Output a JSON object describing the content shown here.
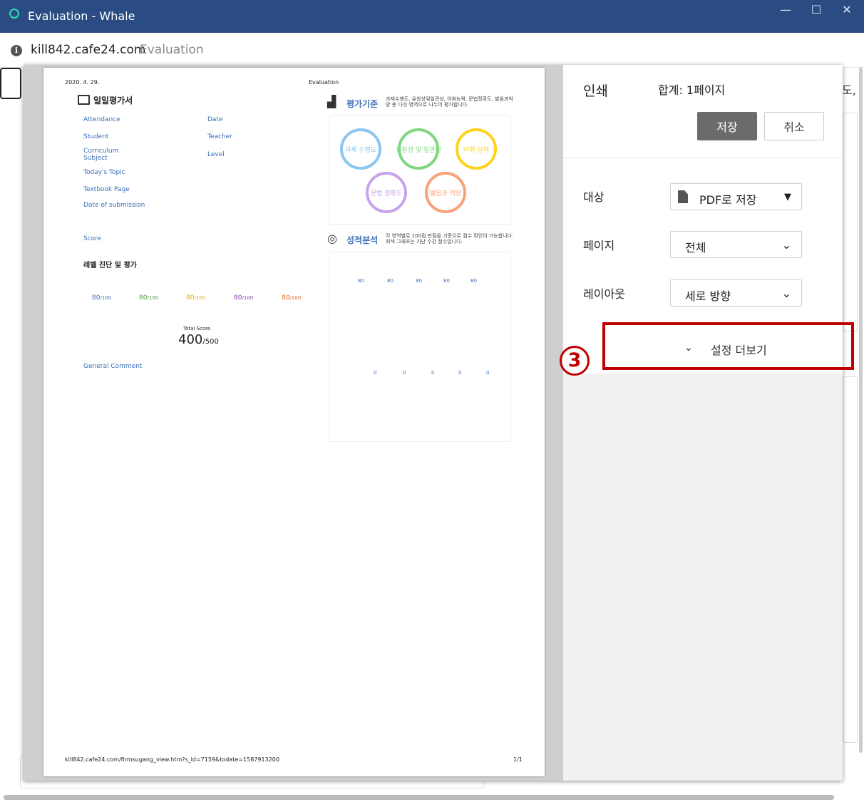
{
  "window": {
    "title": "Evaluation - Whale",
    "controls": {
      "minimize": "—",
      "maximize": "☐",
      "close": "✕"
    }
  },
  "address": {
    "info_icon": "i",
    "url": "kill842.cafe24.com",
    "title": "Evaluation"
  },
  "background": {
    "edge_text": "도,"
  },
  "preview": {
    "date": "2020. 4. 29.",
    "header": "Evaluation",
    "doc_title": "일일평가서",
    "labels": {
      "attendance": "Attendance",
      "date": "Date",
      "student": "Student",
      "teacher": "Teacher",
      "curriculum": "Curriculum",
      "subject": "Subject",
      "level": "Level",
      "topic": "Today's Topic",
      "textbook": "Textbook Page",
      "submission": "Date of submission",
      "score": "Score"
    },
    "level_title": "레벨 진단 및 평가",
    "scores": [
      {
        "value": "80",
        "max": "/100",
        "color": "#3b6fb8"
      },
      {
        "value": "80",
        "max": "/100",
        "color": "#4a9a3a"
      },
      {
        "value": "80",
        "max": "/100",
        "color": "#e0a800"
      },
      {
        "value": "80",
        "max": "/100",
        "color": "#7a3cb8"
      },
      {
        "value": "80",
        "max": "/100",
        "color": "#e0602a"
      }
    ],
    "total_label": "Total Score",
    "total_value": "400",
    "total_max": "/500",
    "general_comment": "General Comment",
    "criteria": {
      "title": "평가기준",
      "desc": "과제수행도, 유창성및일관성, 어휘능력, 문법정확도, 발음과억양 총 다섯 영역으로 나누어 평가합니다.",
      "circles": [
        {
          "label": "과제 수행도",
          "color": "#8ec6ef"
        },
        {
          "label": "유창성 및 일관성",
          "color": "#7fd67f"
        },
        {
          "label": "어휘 능력",
          "color": "#ffd21f"
        },
        {
          "label": "문법 정확도",
          "color": "#c7a3ec"
        },
        {
          "label": "발음과 억양",
          "color": "#f9a27a"
        }
      ]
    },
    "analysis": {
      "title": "성적분석",
      "desc": "각 영역별로 100점 만점을 기준으로 점수 확인이 가능합니다. 회색 그래프는 지난 수강 점수입니다.",
      "top_values": [
        "80",
        "80",
        "80",
        "80",
        "80"
      ],
      "bottom_values": [
        "0",
        "0",
        "0",
        "0",
        "0"
      ]
    },
    "footer_url": "kill842.cafe24.com/firmsugang_view.htm?s_id=7159&todate=1587913200",
    "footer_page": "1/1"
  },
  "settings": {
    "title": "인쇄",
    "total": "합계: 1페이지",
    "save": "저장",
    "cancel": "취소",
    "destination": {
      "label": "대상",
      "value": "PDF로 저장",
      "icon": "pdf-file-icon"
    },
    "pages": {
      "label": "페이지",
      "value": "전체"
    },
    "layout": {
      "label": "레이아웃",
      "value": "세로 방향"
    },
    "more_settings": "설정 더보기"
  },
  "annotation": {
    "step": "3",
    "color": "#c00000"
  }
}
